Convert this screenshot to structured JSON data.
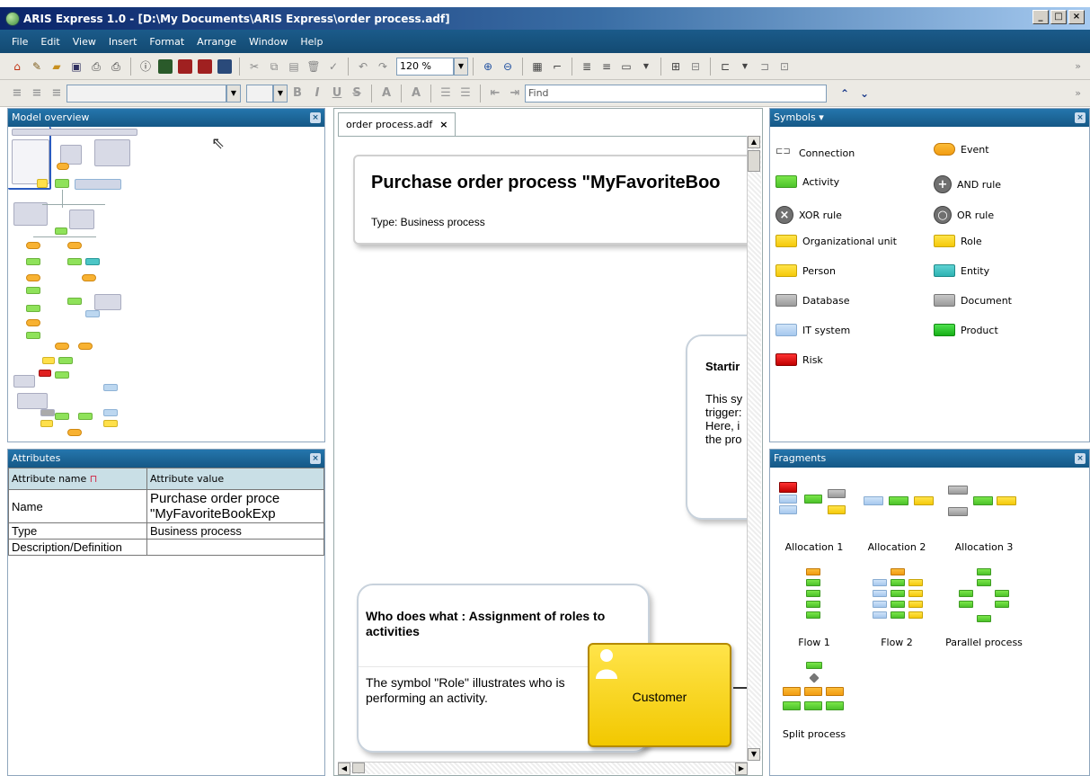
{
  "window": {
    "title": "ARIS Express 1.0 - [D:\\My Documents\\ARIS Express\\order process.adf]",
    "buttons": [
      "_",
      "□",
      "×"
    ]
  },
  "menu": [
    "File",
    "Edit",
    "View",
    "Insert",
    "Format",
    "Arrange",
    "Window",
    "Help"
  ],
  "toolbar": {
    "zoom": "120 %",
    "find_placeholder": "Find",
    "bold": "B",
    "italic": "I",
    "underline": "U",
    "strike": "S",
    "font_color": "A",
    "more": "»"
  },
  "panels": {
    "overview": "Model overview",
    "attributes": "Attributes",
    "symbols": "Symbols ▾",
    "fragments": "Fragments"
  },
  "attributes": {
    "col_name": "Attribute name",
    "col_value": "Attribute value",
    "rows": [
      {
        "name": "Name",
        "value_line1": "Purchase order proce",
        "value_line2": "\"MyFavoriteBookExp"
      },
      {
        "name": "Type",
        "value": "Business process"
      },
      {
        "name": "Description/Definition",
        "value": ""
      }
    ]
  },
  "editor": {
    "tab": "order process.adf",
    "tab_close": "×",
    "header_title": "Purchase order process \"MyFavoriteBoo",
    "header_type": "Type: Business process",
    "start_title": "Startir",
    "start_lines": [
      "This sy",
      "trigger:",
      "Here, i",
      "the pro"
    ],
    "who_title": "Who does what : Assignment of roles to activities",
    "who_text": "The symbol \"Role\" illustrates who is performing an activity.",
    "customer": "Customer"
  },
  "symbols": [
    {
      "label": "Connection",
      "shape": "connection"
    },
    {
      "label": "Event",
      "shape": "event"
    },
    {
      "label": "Activity",
      "shape": "activity"
    },
    {
      "label": "AND rule",
      "shape": "and"
    },
    {
      "label": "XOR rule",
      "shape": "xor"
    },
    {
      "label": "OR rule",
      "shape": "or"
    },
    {
      "label": "Organizational unit",
      "shape": "yellow"
    },
    {
      "label": "Role",
      "shape": "yellow"
    },
    {
      "label": "Person",
      "shape": "yellow"
    },
    {
      "label": "Entity",
      "shape": "teal"
    },
    {
      "label": "Database",
      "shape": "grey"
    },
    {
      "label": "Document",
      "shape": "grey"
    },
    {
      "label": "IT system",
      "shape": "blue"
    },
    {
      "label": "Product",
      "shape": "product"
    },
    {
      "label": "Risk",
      "shape": "red"
    }
  ],
  "fragments": [
    "Allocation 1",
    "Allocation 2",
    "Allocation 3",
    "Flow 1",
    "Flow 2",
    "Parallel process",
    "Split process"
  ],
  "colors": {
    "title_bar": "#0a246a",
    "panel_header": "#155886",
    "activity": "#7be64a",
    "event": "#f8b232",
    "role": "#ffe04a"
  }
}
